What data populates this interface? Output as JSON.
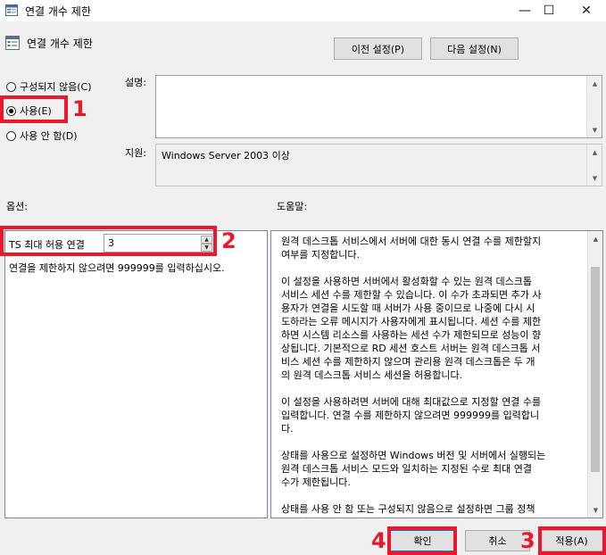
{
  "window": {
    "title": "연결 개수 제한",
    "controls": {
      "minimize": "—",
      "maximize": "☐",
      "close": "✕"
    }
  },
  "header": {
    "title": "연결 개수 제한",
    "prev_button": "이전 설정(P)",
    "next_button": "다음 설정(N)"
  },
  "state": {
    "options": [
      {
        "label": "구성되지 않음(C)",
        "checked": false
      },
      {
        "label": "사용(E)",
        "checked": true
      },
      {
        "label": "사용 안 함(D)",
        "checked": false
      }
    ]
  },
  "description": {
    "label": "설명:",
    "value": ""
  },
  "supported": {
    "label": "지원:",
    "value": "Windows Server 2003 이상"
  },
  "options_section": {
    "label": "옵션:",
    "max_connections_label": "TS 최대 허용 연결",
    "max_connections_value": "3",
    "hint": "연결을 제한하지 않으려면 999999를 입력하십시오."
  },
  "help_section": {
    "label": "도움말:",
    "paragraphs": [
      "원격 데스크톱 서비스에서 서버에 대한 동시 연결 수를 제한할지\n여부를 지정합니다.",
      "이 설정을 사용하면 서버에서 활성화할 수 있는 원격 데스크톱\n서비스 세션 수를 제한할 수 있습니다. 이 수가 초과되면 추가 사\n용자가 연결을 시도할 때 서버가 사용 중이므로 나중에 다시 시\n도하라는 오류 메시지가 사용자에게 표시됩니다. 세션 수를 제한\n하면 시스템 리소스를 사용하는 세션 수가 제한되므로 성능이 향\n상됩니다. 기본적으로 RD 세션 호스트 서버는 원격 데스크톱 서\n비스 세션 수를 제한하지 않으며 관리용 원격 데스크톱은 두 개\n의 원격 데스크톱 서비스 세션을 허용합니다.",
      "이 설정을 사용하려면 서버에 대해 최대값으로 지정할 연결 수를\n입력합니다. 연결 수를 제한하지 않으려면 999999를 입력합니\n다.",
      "상태를 사용으로 설정하면 Windows 버전 및 서버에서 실행되는\n원격 데스크톱 서비스 모드와 일치하는 지정된 수로 최대 연결\n수가 제한됩니다.",
      "상태를 사용 안 함 또는 구성되지 않음으로 설정하면 그룹 정책\n수준에서 연결 수 제한이 적용되지 않습니다."
    ]
  },
  "footer": {
    "ok_button": "확인",
    "cancel_button": "취소",
    "apply_button": "적용(A)"
  },
  "annotations": {
    "m1": "1",
    "m2": "2",
    "m3": "3",
    "m4": "4",
    "color": "#e8192c"
  }
}
